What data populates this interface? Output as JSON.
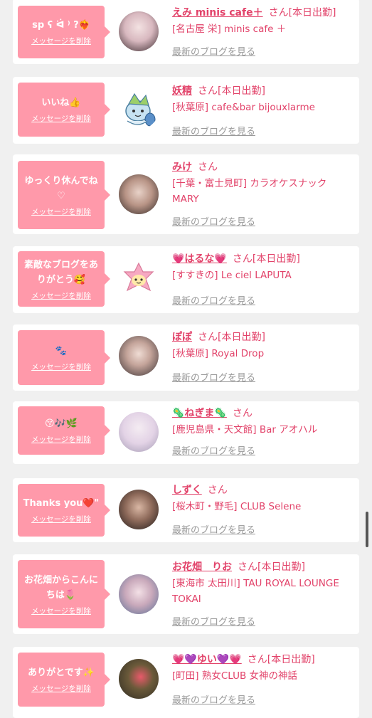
{
  "colors": {
    "bubble": "#ff99aa",
    "accent": "#e2436a",
    "blog_link": "#999999",
    "background": "#f0f0f0"
  },
  "honorific": "さん",
  "delete_label": "メッセージを削除",
  "blog_label": "最新のブログを見る",
  "messages": [
    {
      "message": "sp ʕ ᐛ ⁾ ?❤️‍🔥",
      "name": "えみ minis cafe＋",
      "status": "[本日出勤]",
      "shop": "[名古屋 栄] minis cafe ＋",
      "avatar": "avatar-photo"
    },
    {
      "message": "いいね👍",
      "name": "妖精",
      "status": "[本日出勤]",
      "shop": "[秋葉原] cafe&bar bijouxlarme",
      "avatar": "fairy-character-icon"
    },
    {
      "message": "ゆっくり休んでね♡",
      "name": "みけ",
      "status": "",
      "shop": "[千葉・富士見町] カラオケスナック MARY",
      "avatar": "avatar-photo"
    },
    {
      "message": "素敵なブログをありがとう🥰",
      "name": "💗はるな💗",
      "status": "[本日出勤]",
      "shop": "[すすきの] Le ciel LAPUTA",
      "avatar": "pink-flower-character-icon"
    },
    {
      "message": "🐾",
      "name": "ぽぽ",
      "status": "[本日出勤]",
      "shop": "[秋葉原] Royal Drop",
      "avatar": "avatar-photo"
    },
    {
      "message": "😚🎶🌿",
      "name": "🦠ねぎま🦠",
      "status": "",
      "shop": "[鹿児島県・天文館] Bar アオハル",
      "avatar": "avatar-photo"
    },
    {
      "message": "Thanks you❤️\"",
      "name": "しずく",
      "status": "",
      "shop": "[桜木町・野毛] CLUB Selene",
      "avatar": "avatar-photo"
    },
    {
      "message": "お花畑からこんにちは🌷",
      "name": "お花畑　りお",
      "status": "[本日出勤]",
      "shop": "[東海市 太田川] TAU ROYAL LOUNGE TOKAI",
      "avatar": "avatar-photo"
    },
    {
      "message": "ありがとです✨",
      "name": "💗💜ゆい💜💗",
      "status": "[本日出勤]",
      "shop": "[町田] 熟女CLUB 女神の神話",
      "avatar": "avatar-photo"
    }
  ]
}
